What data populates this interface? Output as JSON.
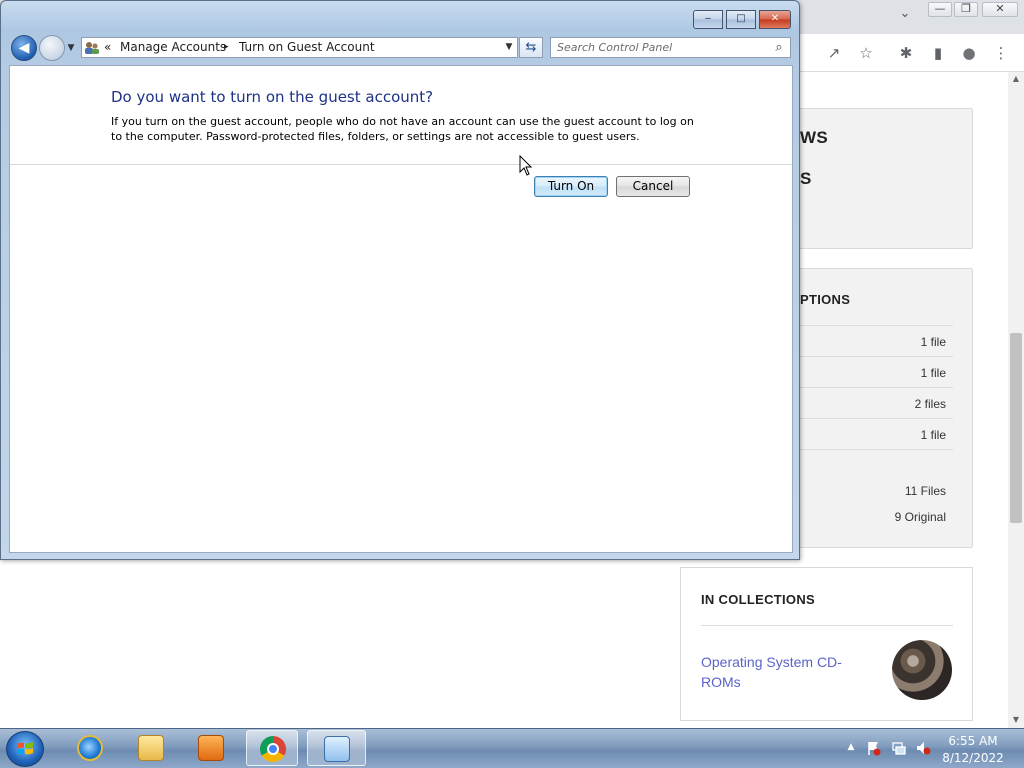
{
  "control_panel": {
    "breadcrumb_overflow": "«",
    "breadcrumb_sep": "▸",
    "breadcrumb": [
      "Manage Accounts",
      "Turn on Guest Account"
    ],
    "search_placeholder": "Search Control Panel",
    "dialog": {
      "title": "Do you want to turn on the guest account?",
      "body": "If you turn on the guest account, people who do not have an account can use the guest account to log on to the computer. Password-protected files, folders, or settings are not accessible to guest users.",
      "turn_on_label": "Turn On",
      "cancel_label": "Cancel"
    },
    "caption": {
      "minimize": "‒",
      "maximize": "□",
      "close": "✕"
    }
  },
  "browser": {
    "tab_dropdown": "⌄",
    "window_controls": {
      "minimize": "—",
      "restore": "❐",
      "close": "✕"
    },
    "toolbar_icons": {
      "share": "↗",
      "star": "☆",
      "extensions": "✱",
      "sidepanel": "▮",
      "profile": "●",
      "menu": "⋮"
    },
    "page": {
      "fragment_1": "WS",
      "fragment_2": "S",
      "options_title_fragment": "PTIONS",
      "file_rows": [
        "1 file",
        "1 file",
        "2 files",
        "1 file"
      ],
      "total_files": "11 Files",
      "original_count": "9 Original",
      "collections_title": "IN COLLECTIONS",
      "collection_link": "Operating System CD-ROMs"
    }
  },
  "taskbar": {
    "apps": [
      "windows-explorer",
      "internet-explorer",
      "file-explorer",
      "media-player",
      "chrome",
      "control-panel"
    ],
    "clock_time": "6:55 AM",
    "clock_date": "8/12/2022"
  },
  "colors": {
    "dialog_title": "#1e3287",
    "link": "#5a64c8",
    "taskbar": "#7f9bbd"
  }
}
